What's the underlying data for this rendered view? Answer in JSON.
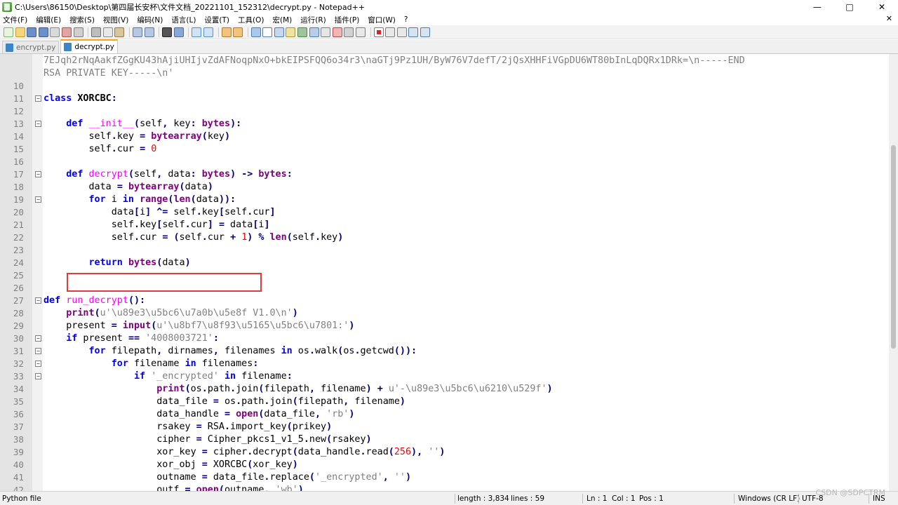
{
  "window": {
    "title": "C:\\Users\\86150\\Desktop\\第四届长安杯\\文件文档_20221101_152312\\decrypt.py - Notepad++",
    "minimize": "—",
    "maximize": "□",
    "close": "✕"
  },
  "menu": {
    "items": [
      "文件(F)",
      "编辑(E)",
      "搜索(S)",
      "视图(V)",
      "编码(N)",
      "语言(L)",
      "设置(T)",
      "工具(O)",
      "宏(M)",
      "运行(R)",
      "插件(P)",
      "窗口(W)",
      "?"
    ],
    "close": "✕"
  },
  "tabs": [
    {
      "label": "encrypt.py",
      "active": false
    },
    {
      "label": "decrypt.py",
      "active": true
    }
  ],
  "editor": {
    "wrap_lines": [
      "7EJqh2rNqAakfZGgKU43hAjiUHIjvZdAFNoqpNxO+bkEIPSFQQ6o34r3\\naGTj9Pz1UH/ByW76V7defT/2jQsXHHFiVGpDU6WT80bInLqDQRx1DRk=\\n-----END",
      "RSA PRIVATE KEY-----\\n'"
    ],
    "lines": [
      {
        "n": "10",
        "html": ""
      },
      {
        "n": "11",
        "html": "<span class='kw'>class</span> <span class='cls'>XORCBC</span><span class='op'>:</span>"
      },
      {
        "n": "12",
        "html": ""
      },
      {
        "n": "13",
        "html": "    <span class='kw'>def</span> <span class='fn'>__init__</span><span class='op'>(</span>self<span class='op'>,</span> key<span class='op'>:</span> <span class='bi'>bytes</span><span class='op'>):</span>"
      },
      {
        "n": "14",
        "html": "        self<span class='op'>.</span>key <span class='op'>=</span> <span class='bi'>bytearray</span><span class='op'>(</span>key<span class='op'>)</span>"
      },
      {
        "n": "15",
        "html": "        self<span class='op'>.</span>cur <span class='op'>=</span> <span class='num'>0</span>"
      },
      {
        "n": "16",
        "html": ""
      },
      {
        "n": "17",
        "html": "    <span class='kw'>def</span> <span class='fn'>decrypt</span><span class='op'>(</span>self<span class='op'>,</span> data<span class='op'>:</span> <span class='bi'>bytes</span><span class='op'>)</span> <span class='op'>-&gt;</span> <span class='bi'>bytes</span><span class='op'>:</span>"
      },
      {
        "n": "18",
        "html": "        data <span class='op'>=</span> <span class='bi'>bytearray</span><span class='op'>(</span>data<span class='op'>)</span>"
      },
      {
        "n": "19",
        "html": "        <span class='kw'>for</span> i <span class='kw'>in</span> <span class='bi'>range</span><span class='op'>(</span><span class='bi'>len</span><span class='op'>(</span>data<span class='op'>)):</span>"
      },
      {
        "n": "20",
        "html": "            data<span class='op'>[</span>i<span class='op'>]</span> <span class='op'>^=</span> self<span class='op'>.</span>key<span class='op'>[</span>self<span class='op'>.</span>cur<span class='op'>]</span>"
      },
      {
        "n": "21",
        "html": "            self<span class='op'>.</span>key<span class='op'>[</span>self<span class='op'>.</span>cur<span class='op'>]</span> <span class='op'>=</span> data<span class='op'>[</span>i<span class='op'>]</span>"
      },
      {
        "n": "22",
        "html": "            self<span class='op'>.</span>cur <span class='op'>=</span> <span class='op'>(</span>self<span class='op'>.</span>cur <span class='op'>+</span> <span class='num'>1</span><span class='op'>)</span> <span class='op'>%</span> <span class='bi'>len</span><span class='op'>(</span>self<span class='op'>.</span>key<span class='op'>)</span>"
      },
      {
        "n": "23",
        "html": ""
      },
      {
        "n": "24",
        "html": "        <span class='kw'>return</span> <span class='bi'>bytes</span><span class='op'>(</span>data<span class='op'>)</span>"
      },
      {
        "n": "25",
        "html": ""
      },
      {
        "n": "26",
        "html": ""
      },
      {
        "n": "27",
        "html": "<span class='kw'>def</span> <span class='fn'>run_decrypt</span><span class='op'>():</span>"
      },
      {
        "n": "28",
        "html": "    <span class='bi'>print</span><span class='op'>(</span><span class='str'>u'\\u89e3\\u5bc6\\u7a0b\\u5e8f V1.0\\n'</span><span class='op'>)</span>"
      },
      {
        "n": "29",
        "html": "    present <span class='op'>=</span> <span class='bi'>input</span><span class='op'>(</span><span class='str'>u'\\u8bf7\\u8f93\\u5165\\u5bc6\\u7801:'</span><span class='op'>)</span>"
      },
      {
        "n": "30",
        "html": "    <span class='kw'>if</span> present <span class='op'>==</span> <span class='str'>'4008003721'</span><span class='op'>:</span>"
      },
      {
        "n": "31",
        "html": "        <span class='kw'>for</span> filepath<span class='op'>,</span> dirnames<span class='op'>,</span> filenames <span class='kw'>in</span> os<span class='op'>.</span>walk<span class='op'>(</span>os<span class='op'>.</span>getcwd<span class='op'>()):</span>"
      },
      {
        "n": "32",
        "html": "            <span class='kw'>for</span> filename <span class='kw'>in</span> filenames<span class='op'>:</span>"
      },
      {
        "n": "33",
        "html": "                <span class='kw'>if</span> <span class='str'>'_encrypted'</span> <span class='kw'>in</span> filename<span class='op'>:</span>"
      },
      {
        "n": "34",
        "html": "                    <span class='bi'>print</span><span class='op'>(</span>os<span class='op'>.</span>path<span class='op'>.</span>join<span class='op'>(</span>filepath<span class='op'>,</span> filename<span class='op'>)</span> <span class='op'>+</span> <span class='str'>u'-\\u89e3\\u5bc6\\u6210\\u529f'</span><span class='op'>)</span>"
      },
      {
        "n": "35",
        "html": "                    data_file <span class='op'>=</span> os<span class='op'>.</span>path<span class='op'>.</span>join<span class='op'>(</span>filepath<span class='op'>,</span> filename<span class='op'>)</span>"
      },
      {
        "n": "36",
        "html": "                    data_handle <span class='op'>=</span> <span class='bi'>open</span><span class='op'>(</span>data_file<span class='op'>,</span> <span class='str'>'rb'</span><span class='op'>)</span>"
      },
      {
        "n": "37",
        "html": "                    rsakey <span class='op'>=</span> RSA<span class='op'>.</span>import_key<span class='op'>(</span>prikey<span class='op'>)</span>"
      },
      {
        "n": "38",
        "html": "                    cipher <span class='op'>=</span> Cipher_pkcs1_v1_5<span class='op'>.</span>new<span class='op'>(</span>rsakey<span class='op'>)</span>"
      },
      {
        "n": "39",
        "html": "                    xor_key <span class='op'>=</span> cipher<span class='op'>.</span>decrypt<span class='op'>(</span>data_handle<span class='op'>.</span>read<span class='op'>(</span><span class='num'>256</span><span class='op'>),</span> <span class='str'>''</span><span class='op'>)</span>"
      },
      {
        "n": "40",
        "html": "                    xor_obj <span class='op'>=</span> XORCBC<span class='op'>(</span>xor_key<span class='op'>)</span>"
      },
      {
        "n": "41",
        "html": "                    outname <span class='op'>=</span> data_file<span class='op'>.</span>replace<span class='op'>(</span><span class='str'>'_encrypted'</span><span class='op'>,</span> <span class='str'>''</span><span class='op'>)</span>"
      },
      {
        "n": "42",
        "html": "                    outf <span class='op'>=</span> <span class='bi'>open</span><span class='op'>(</span>outname<span class='op'>,</span> <span class='str'>'wb'</span><span class='op'>)</span>"
      }
    ],
    "fold_lines": [
      "11",
      "13",
      "17",
      "19",
      "27",
      "30",
      "31",
      "32",
      "33"
    ]
  },
  "status": {
    "language": "Python file",
    "length": "length : 3,834",
    "lines": "lines : 59",
    "ln": "Ln : 1",
    "col": "Col : 1",
    "pos": "Pos : 1",
    "eol": "Windows (CR LF)",
    "encoding": "UTF-8",
    "mode": "INS"
  },
  "watermark": "CSDN @SDPCTRM",
  "colors": {
    "keyword": "#0000ff",
    "function": "#ff00ff",
    "number": "#ff0000",
    "string": "#808080",
    "highlight_box": "#e33a3a",
    "active_tab_accent": "#f5a623"
  }
}
